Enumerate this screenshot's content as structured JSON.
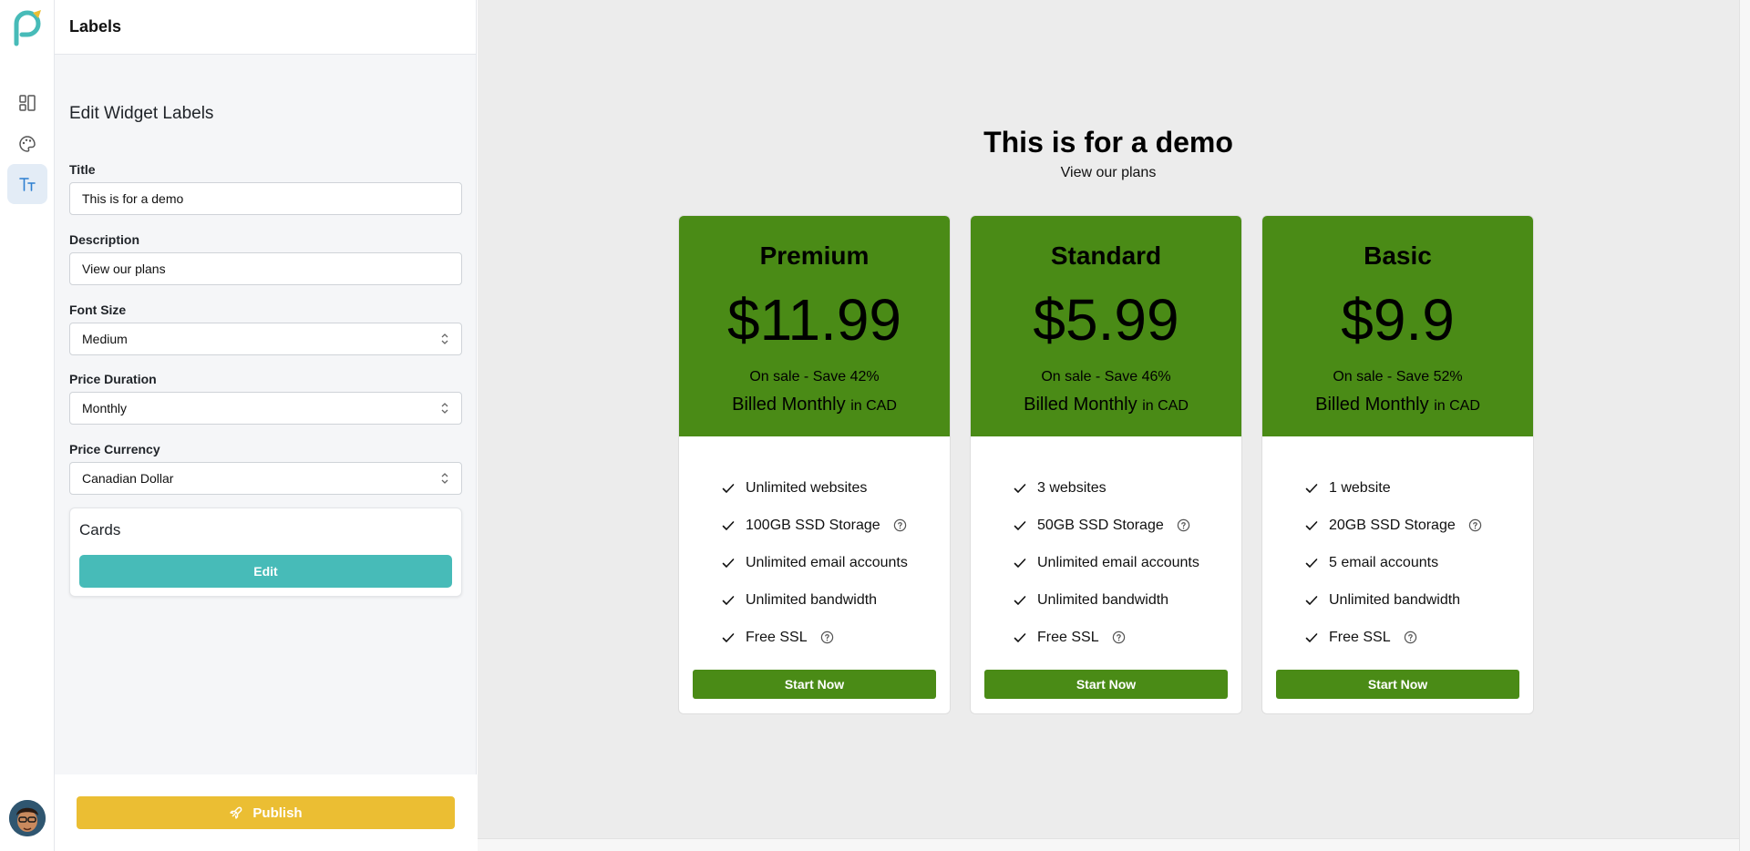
{
  "panel": {
    "title": "Labels",
    "section_title": "Edit Widget Labels"
  },
  "form": {
    "title": {
      "label": "Title",
      "value": "This is for a demo"
    },
    "description": {
      "label": "Description",
      "value": "View our plans"
    },
    "font_size": {
      "label": "Font Size",
      "value": "Medium"
    },
    "price_duration": {
      "label": "Price Duration",
      "value": "Monthly"
    },
    "price_currency": {
      "label": "Price Currency",
      "value": "Canadian Dollar"
    }
  },
  "cards": {
    "title": "Cards",
    "edit_label": "Edit"
  },
  "publish_label": "Publish",
  "rail": {
    "icons": [
      "layout-icon",
      "palette-icon",
      "text-size-icon"
    ],
    "active": "text-size-icon"
  },
  "colors": {
    "accent_teal": "#47bbb8",
    "publish_yellow": "#ebbe33",
    "plan_green": "#4a8b16"
  },
  "widget": {
    "title": "This is for a demo",
    "description": "View our plans",
    "plans": [
      {
        "name": "Premium",
        "price": "$11.99",
        "sale": "On sale - Save 42%",
        "billed": "Billed Monthly",
        "currency_note": "in CAD",
        "features": [
          {
            "text": "Unlimited websites",
            "help": false
          },
          {
            "text": "100GB SSD Storage",
            "help": true
          },
          {
            "text": "Unlimited email accounts",
            "help": false
          },
          {
            "text": "Unlimited bandwidth",
            "help": false
          },
          {
            "text": "Free SSL",
            "help": true
          }
        ],
        "cta": "Start Now"
      },
      {
        "name": "Standard",
        "price": "$5.99",
        "sale": "On sale - Save 46%",
        "billed": "Billed Monthly",
        "currency_note": "in CAD",
        "features": [
          {
            "text": "3 websites",
            "help": false
          },
          {
            "text": "50GB SSD Storage",
            "help": true
          },
          {
            "text": "Unlimited email accounts",
            "help": false
          },
          {
            "text": "Unlimited bandwidth",
            "help": false
          },
          {
            "text": "Free SSL",
            "help": true
          }
        ],
        "cta": "Start Now"
      },
      {
        "name": "Basic",
        "price": "$9.9",
        "sale": "On sale - Save 52%",
        "billed": "Billed Monthly",
        "currency_note": "in CAD",
        "features": [
          {
            "text": "1 website",
            "help": false
          },
          {
            "text": "20GB SSD Storage",
            "help": true
          },
          {
            "text": "5 email accounts",
            "help": false
          },
          {
            "text": "Unlimited bandwidth",
            "help": false
          },
          {
            "text": "Free SSL",
            "help": true
          }
        ],
        "cta": "Start Now"
      }
    ]
  }
}
